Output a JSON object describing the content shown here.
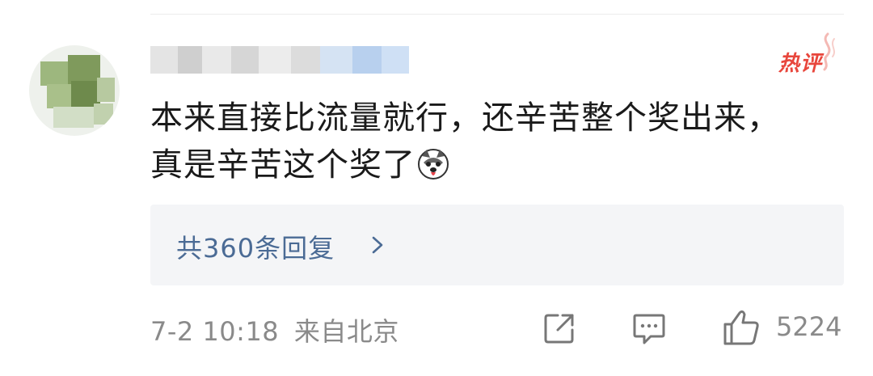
{
  "comment": {
    "username_blurred": true,
    "badge": "热评",
    "text_line1": "本来直接比流量就行，还辛苦整个奖出来，",
    "text_line2": "真是辛苦这个奖了",
    "emoji": "husky-dog-emoji",
    "replies_label": "共360条回复",
    "timestamp": "7-2 10:18",
    "location": "来自北京",
    "like_count": "5224"
  },
  "colors": {
    "badge": "#e8463c",
    "link": "#4b6b95",
    "meta": "#8a8a8a",
    "text": "#1a1a1a",
    "reply_bg": "#f4f5f7"
  },
  "icons": {
    "share": "share-external-icon",
    "comment": "comment-bubble-icon",
    "like": "thumbs-up-icon",
    "chevron": "chevron-right-icon"
  }
}
